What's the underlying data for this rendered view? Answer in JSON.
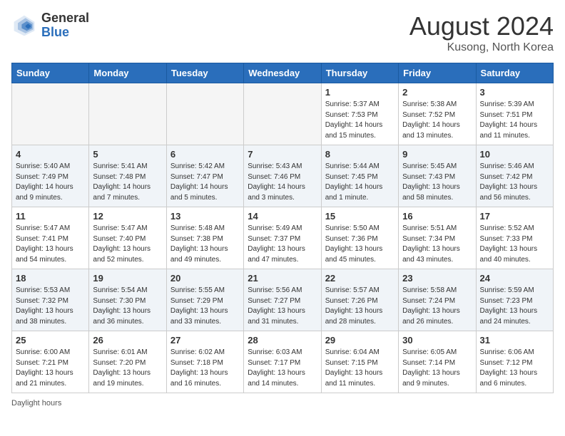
{
  "header": {
    "logo_general": "General",
    "logo_blue": "Blue",
    "month": "August 2024",
    "location": "Kusong, North Korea"
  },
  "days_of_week": [
    "Sunday",
    "Monday",
    "Tuesday",
    "Wednesday",
    "Thursday",
    "Friday",
    "Saturday"
  ],
  "weeks": [
    [
      {
        "day": "",
        "info": ""
      },
      {
        "day": "",
        "info": ""
      },
      {
        "day": "",
        "info": ""
      },
      {
        "day": "",
        "info": ""
      },
      {
        "day": "1",
        "info": "Sunrise: 5:37 AM\nSunset: 7:53 PM\nDaylight: 14 hours\nand 15 minutes."
      },
      {
        "day": "2",
        "info": "Sunrise: 5:38 AM\nSunset: 7:52 PM\nDaylight: 14 hours\nand 13 minutes."
      },
      {
        "day": "3",
        "info": "Sunrise: 5:39 AM\nSunset: 7:51 PM\nDaylight: 14 hours\nand 11 minutes."
      }
    ],
    [
      {
        "day": "4",
        "info": "Sunrise: 5:40 AM\nSunset: 7:49 PM\nDaylight: 14 hours\nand 9 minutes."
      },
      {
        "day": "5",
        "info": "Sunrise: 5:41 AM\nSunset: 7:48 PM\nDaylight: 14 hours\nand 7 minutes."
      },
      {
        "day": "6",
        "info": "Sunrise: 5:42 AM\nSunset: 7:47 PM\nDaylight: 14 hours\nand 5 minutes."
      },
      {
        "day": "7",
        "info": "Sunrise: 5:43 AM\nSunset: 7:46 PM\nDaylight: 14 hours\nand 3 minutes."
      },
      {
        "day": "8",
        "info": "Sunrise: 5:44 AM\nSunset: 7:45 PM\nDaylight: 14 hours\nand 1 minute."
      },
      {
        "day": "9",
        "info": "Sunrise: 5:45 AM\nSunset: 7:43 PM\nDaylight: 13 hours\nand 58 minutes."
      },
      {
        "day": "10",
        "info": "Sunrise: 5:46 AM\nSunset: 7:42 PM\nDaylight: 13 hours\nand 56 minutes."
      }
    ],
    [
      {
        "day": "11",
        "info": "Sunrise: 5:47 AM\nSunset: 7:41 PM\nDaylight: 13 hours\nand 54 minutes."
      },
      {
        "day": "12",
        "info": "Sunrise: 5:47 AM\nSunset: 7:40 PM\nDaylight: 13 hours\nand 52 minutes."
      },
      {
        "day": "13",
        "info": "Sunrise: 5:48 AM\nSunset: 7:38 PM\nDaylight: 13 hours\nand 49 minutes."
      },
      {
        "day": "14",
        "info": "Sunrise: 5:49 AM\nSunset: 7:37 PM\nDaylight: 13 hours\nand 47 minutes."
      },
      {
        "day": "15",
        "info": "Sunrise: 5:50 AM\nSunset: 7:36 PM\nDaylight: 13 hours\nand 45 minutes."
      },
      {
        "day": "16",
        "info": "Sunrise: 5:51 AM\nSunset: 7:34 PM\nDaylight: 13 hours\nand 43 minutes."
      },
      {
        "day": "17",
        "info": "Sunrise: 5:52 AM\nSunset: 7:33 PM\nDaylight: 13 hours\nand 40 minutes."
      }
    ],
    [
      {
        "day": "18",
        "info": "Sunrise: 5:53 AM\nSunset: 7:32 PM\nDaylight: 13 hours\nand 38 minutes."
      },
      {
        "day": "19",
        "info": "Sunrise: 5:54 AM\nSunset: 7:30 PM\nDaylight: 13 hours\nand 36 minutes."
      },
      {
        "day": "20",
        "info": "Sunrise: 5:55 AM\nSunset: 7:29 PM\nDaylight: 13 hours\nand 33 minutes."
      },
      {
        "day": "21",
        "info": "Sunrise: 5:56 AM\nSunset: 7:27 PM\nDaylight: 13 hours\nand 31 minutes."
      },
      {
        "day": "22",
        "info": "Sunrise: 5:57 AM\nSunset: 7:26 PM\nDaylight: 13 hours\nand 28 minutes."
      },
      {
        "day": "23",
        "info": "Sunrise: 5:58 AM\nSunset: 7:24 PM\nDaylight: 13 hours\nand 26 minutes."
      },
      {
        "day": "24",
        "info": "Sunrise: 5:59 AM\nSunset: 7:23 PM\nDaylight: 13 hours\nand 24 minutes."
      }
    ],
    [
      {
        "day": "25",
        "info": "Sunrise: 6:00 AM\nSunset: 7:21 PM\nDaylight: 13 hours\nand 21 minutes."
      },
      {
        "day": "26",
        "info": "Sunrise: 6:01 AM\nSunset: 7:20 PM\nDaylight: 13 hours\nand 19 minutes."
      },
      {
        "day": "27",
        "info": "Sunrise: 6:02 AM\nSunset: 7:18 PM\nDaylight: 13 hours\nand 16 minutes."
      },
      {
        "day": "28",
        "info": "Sunrise: 6:03 AM\nSunset: 7:17 PM\nDaylight: 13 hours\nand 14 minutes."
      },
      {
        "day": "29",
        "info": "Sunrise: 6:04 AM\nSunset: 7:15 PM\nDaylight: 13 hours\nand 11 minutes."
      },
      {
        "day": "30",
        "info": "Sunrise: 6:05 AM\nSunset: 7:14 PM\nDaylight: 13 hours\nand 9 minutes."
      },
      {
        "day": "31",
        "info": "Sunrise: 6:06 AM\nSunset: 7:12 PM\nDaylight: 13 hours\nand 6 minutes."
      }
    ]
  ],
  "footer": {
    "daylight_label": "Daylight hours"
  }
}
